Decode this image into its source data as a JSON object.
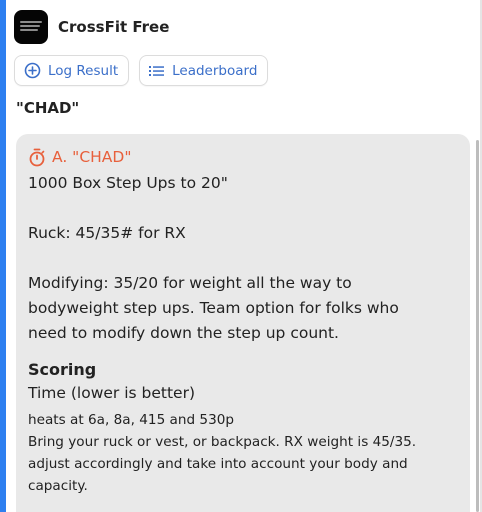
{
  "app": {
    "title": "CrossFit Free"
  },
  "actions": {
    "log_result": "Log Result",
    "leaderboard": "Leaderboard"
  },
  "page": {
    "title": "\"CHAD\""
  },
  "workout": {
    "label": "A. \"CHAD\"",
    "description": "1000 Box Step Ups to 20\"\n\nRuck: 45/35# for RX\n\nModifying: 35/20 for weight all the way to\nbodyweight step ups. Team option for folks who\nneed to modify down the step up count.",
    "scoring_heading": "Scoring",
    "scoring_type": "Time (lower is better)",
    "notes": "heats at 6a, 8a, 415 and 530p\nBring your ruck or vest, or backpack. RX weight is 45/35.\nadjust accordingly and take into account your body and\ncapacity."
  },
  "colors": {
    "accent": "#e8603c",
    "link": "#3b6fc9",
    "edge": "#2d7ff0",
    "card": "#e9e9e9"
  },
  "icons": {
    "log": "plus-circle-icon",
    "leaderboard": "list-icon",
    "workout": "stopwatch-icon"
  }
}
